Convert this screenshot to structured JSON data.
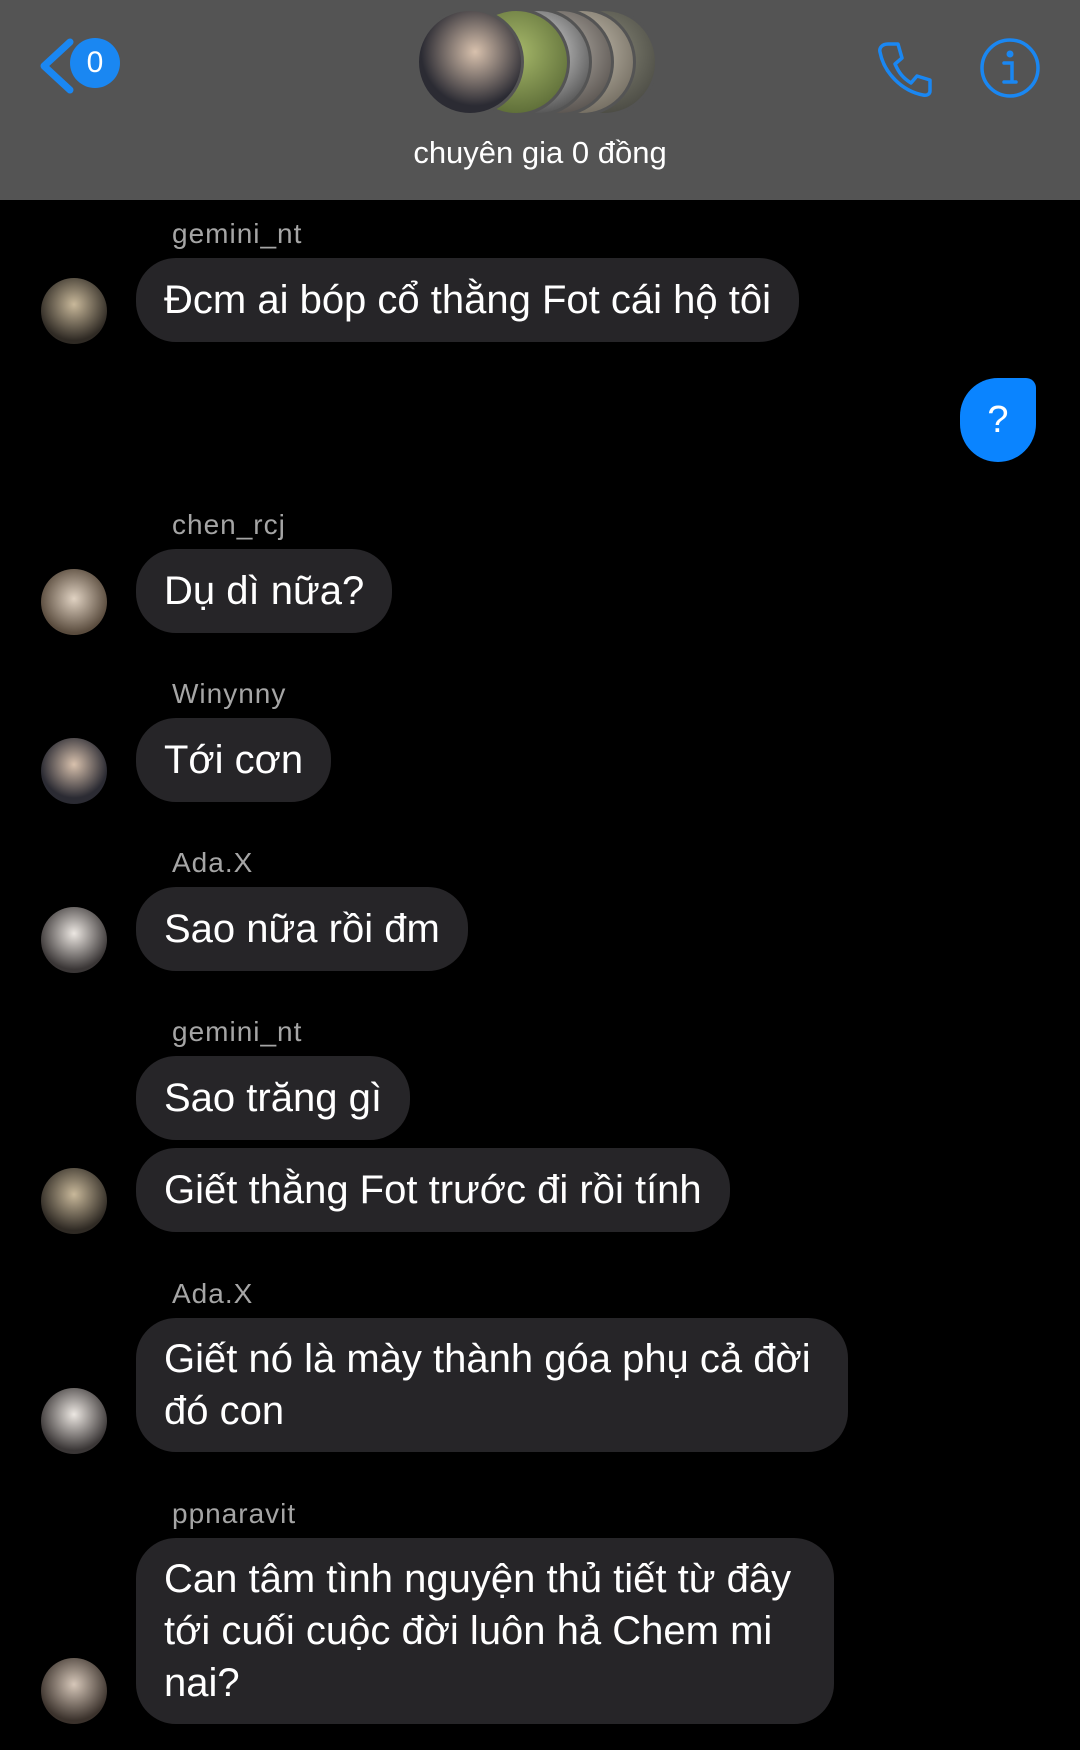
{
  "header": {
    "back_badge": "0",
    "group_name": "chuyên gia 0 đồng",
    "accent_color": "#1a87f2",
    "icons": [
      "chevron-left-icon",
      "phone-icon",
      "info-icon"
    ]
  },
  "messages": [
    {
      "sender": "gemini_nt",
      "text": "Đcm ai bóp cổ thằng Fot cái hộ tôi"
    },
    {
      "mine_text": "?"
    },
    {
      "sender": "chen_rcj",
      "text": "Dụ dì nữa?"
    },
    {
      "sender": "Winynny",
      "text": "Tới cơn"
    },
    {
      "sender": "Ada.X",
      "text": "Sao nữa rồi đm"
    },
    {
      "sender": "gemini_nt",
      "text": "Sao trăng gì",
      "text2": "Giết thằng Fot trước đi rồi tính"
    },
    {
      "sender": "Ada.X",
      "text": "Giết nó là mày thành góa phụ cả đời đó con"
    },
    {
      "sender": "ppnaravit",
      "text": "Can tâm tình nguyện thủ tiết từ đây tới cuối cuộc đời luôn hả Chem mi nai?"
    }
  ],
  "colors": {
    "header_bg": "#545454",
    "bubble_received": "#262528",
    "bubble_sent": "#0a84ff",
    "sender_name": "#a5a5a5"
  }
}
